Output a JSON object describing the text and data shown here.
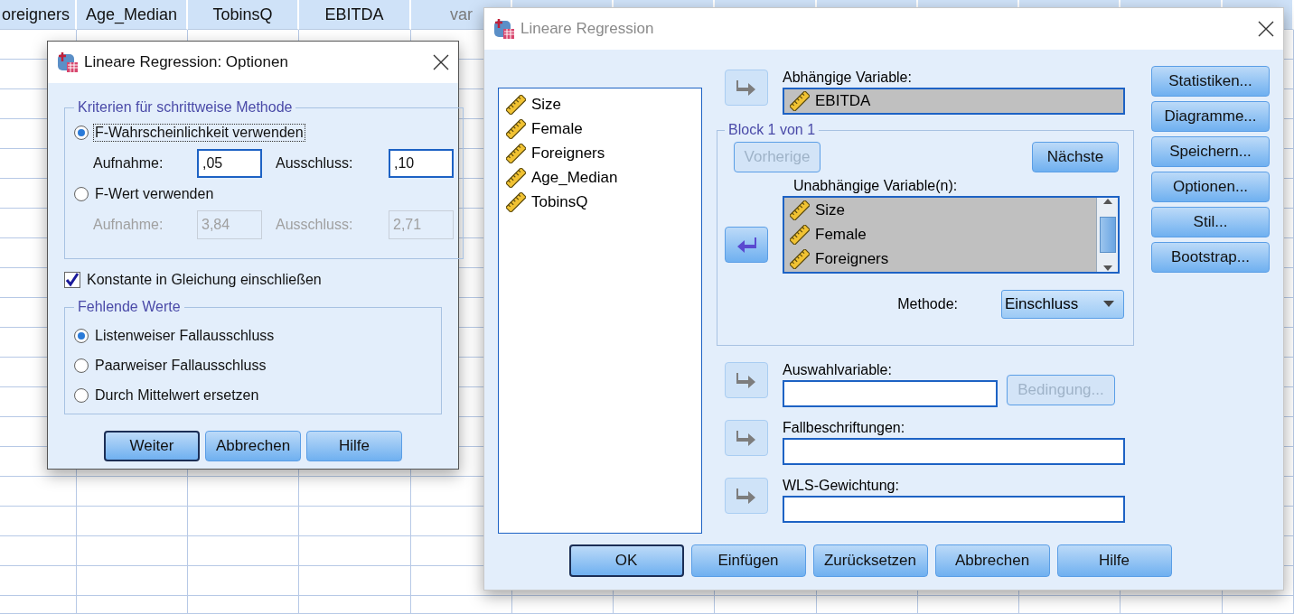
{
  "spreadsheet": {
    "columns": [
      "oreigners",
      "Age_Median",
      "TobinsQ",
      "EBITDA",
      "var"
    ]
  },
  "options_dialog": {
    "title": "Lineare Regression: Optionen",
    "stepwise_group": {
      "title": "Kriterien für schrittweise Methode",
      "methods": [
        {
          "label": "F-Wahrscheinlichkeit verwenden",
          "selected": true,
          "focused": true,
          "disabled": false,
          "entry_label": "Aufnahme:",
          "entry_value": ",05",
          "removal_label": "Ausschluss:",
          "removal_value": ",10"
        },
        {
          "label": "F-Wert verwenden",
          "selected": false,
          "focused": false,
          "disabled": true,
          "entry_label": "Aufnahme:",
          "entry_value": "3,84",
          "removal_label": "Ausschluss:",
          "removal_value": "2,71"
        }
      ]
    },
    "include_constant": {
      "label": "Konstante in Gleichung einschließen",
      "checked": true
    },
    "missing_group": {
      "title": "Fehlende Werte",
      "options": [
        {
          "label": "Listenweiser Fallausschluss",
          "selected": true
        },
        {
          "label": "Paarweiser Fallausschluss",
          "selected": false
        },
        {
          "label": "Durch Mittelwert ersetzen",
          "selected": false
        }
      ]
    },
    "buttons": [
      {
        "label": "Weiter",
        "default": true
      },
      {
        "label": "Abbrechen",
        "default": false
      },
      {
        "label": "Hilfe",
        "default": false
      }
    ]
  },
  "main_dialog": {
    "title": "Lineare Regression",
    "source_variables": [
      "Size",
      "Female",
      "Foreigners",
      "Age_Median",
      "TobinsQ"
    ],
    "dependent": {
      "label": "Abhängige Variable:",
      "variables": [
        "EBITDA"
      ]
    },
    "block": {
      "title": "Block 1 von 1",
      "previous": {
        "label": "Vorherige",
        "disabled": true
      },
      "next": {
        "label": "Nächste",
        "disabled": false
      },
      "independent_label": "Unabhängige Variable(n):",
      "independent_variables": [
        "Size",
        "Female",
        "Foreigners"
      ],
      "method_label": "Methode:",
      "method_value": "Einschluss"
    },
    "selection": {
      "label": "Auswahlvariable:",
      "condition_button": {
        "label": "Bedingung...",
        "disabled": true
      }
    },
    "case_labels": {
      "label": "Fallbeschriftungen:"
    },
    "wls_weight": {
      "label": "WLS-Gewichtung:"
    },
    "side_buttons": [
      {
        "label": "Statistiken..."
      },
      {
        "label": "Diagramme..."
      },
      {
        "label": "Speichern..."
      },
      {
        "label": "Optionen..."
      },
      {
        "label": "Stil..."
      },
      {
        "label": "Bootstrap..."
      }
    ],
    "buttons": [
      {
        "label": "OK",
        "default": true
      },
      {
        "label": "Einfügen",
        "default": false
      },
      {
        "label": "Zurücksetzen",
        "default": false
      },
      {
        "label": "Abbrechen",
        "default": false
      },
      {
        "label": "Hilfe",
        "default": false
      }
    ]
  }
}
